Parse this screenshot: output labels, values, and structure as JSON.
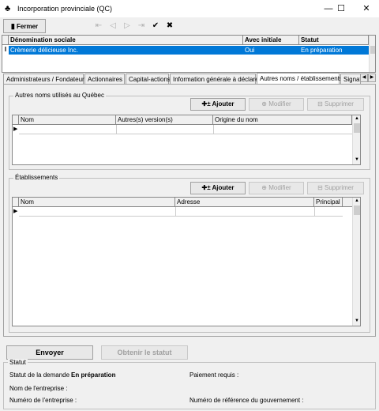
{
  "window": {
    "title": "Incorporation provinciale (QC)",
    "minimize": "—",
    "maximize": "☐",
    "close": "✕"
  },
  "toolbar": {
    "close_label": "Fermer",
    "icons": [
      "first-icon",
      "previous-icon",
      "next-icon",
      "last-icon",
      "check-icon",
      "cancel-icon"
    ]
  },
  "companies": {
    "columns": [
      "Dénomination sociale",
      "Avec initiale",
      "Statut"
    ],
    "rows": [
      [
        "Crèmerie délicieuse Inc.",
        "Oui",
        "En préparation"
      ]
    ],
    "row_indicator": "I"
  },
  "tabs": [
    "Administrateurs / Fondateurs",
    "Actionnaires",
    "Capital-actions",
    "Information générale à déclarer",
    "Autres noms / établissements",
    "Signat"
  ],
  "other_names": {
    "legend": "Autres noms utilisés au Québec",
    "add_label": "Ajouter",
    "modify_label": "Modifier",
    "delete_label": "Supprimer",
    "columns": [
      "Nom",
      "Autres(s) version(s)",
      "Origine du nom"
    ]
  },
  "establishments": {
    "legend": "Établissements",
    "add_label": "Ajouter",
    "modify_label": "Modifier",
    "delete_label": "Supprimer",
    "columns": [
      "Nom",
      "Adresse",
      "Principal"
    ]
  },
  "actions": {
    "send_label": "Envoyer",
    "status_label": "Obtenir le statut"
  },
  "status": {
    "legend": "Statut",
    "request_status_label": "Statut de la demande :",
    "request_status_value": "En préparation",
    "company_name_label": "Nom de l'entreprise :",
    "company_number_label": "Numéro de l'entreprise :",
    "payment_label": "Paiement requis :",
    "gov_ref_label": "Numéro de référence du gouvernement :"
  },
  "colors": {
    "selection": "#0078d7",
    "window_bg": "#f0f0f0"
  }
}
